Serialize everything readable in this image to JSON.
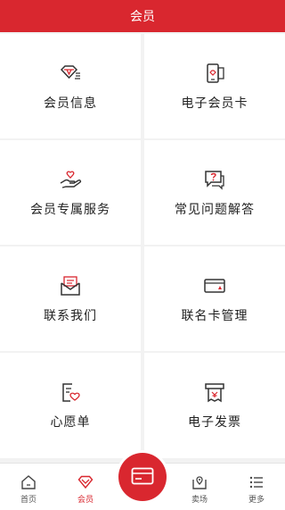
{
  "header": {
    "title": "会员"
  },
  "grid": [
    {
      "label": "会员信息",
      "icon": "diamond-card-icon"
    },
    {
      "label": "电子会员卡",
      "icon": "phone-card-icon"
    },
    {
      "label": "会员专属服务",
      "icon": "hand-heart-icon"
    },
    {
      "label": "常见问题解答",
      "icon": "question-bubble-icon"
    },
    {
      "label": "联系我们",
      "icon": "envelope-icon"
    },
    {
      "label": "联名卡管理",
      "icon": "bank-card-icon"
    },
    {
      "label": "心愿单",
      "icon": "wishlist-icon"
    },
    {
      "label": "电子发票",
      "icon": "invoice-icon"
    }
  ],
  "tabbar": {
    "items": [
      {
        "label": "首页",
        "icon": "home-icon"
      },
      {
        "label": "会员",
        "icon": "diamond-icon",
        "active": true
      },
      {
        "label": "",
        "icon": "card-icon"
      },
      {
        "label": "卖场",
        "icon": "store-location-icon"
      },
      {
        "label": "更多",
        "icon": "more-list-icon"
      }
    ]
  },
  "colors": {
    "accent": "#d9272f",
    "background": "#f2f2f2",
    "text": "#222222"
  }
}
